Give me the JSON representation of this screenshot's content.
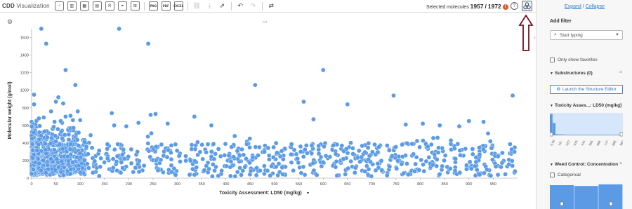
{
  "app": {
    "logo_main": "CDD",
    "logo_sub": " Visualization"
  },
  "toolbar": {
    "tools": [
      {
        "name": "scatter-plot-icon",
        "glyph": "⁘"
      },
      {
        "name": "bar-chart-icon",
        "glyph": "▥"
      },
      {
        "name": "histogram-icon",
        "glyph": "▦"
      },
      {
        "name": "grouped-chart-icon",
        "glyph": "▤"
      },
      {
        "name": "r-script-icon",
        "glyph": "R"
      },
      {
        "name": "structure-view-icon",
        "glyph": "⚭"
      },
      {
        "name": "grid-view-icon",
        "glyph": "⊞"
      }
    ],
    "exports": [
      {
        "name": "export-png-icon",
        "glyph": "PNG"
      },
      {
        "name": "export-pdf-icon",
        "glyph": "PDF"
      },
      {
        "name": "export-excel-icon",
        "glyph": "EXCEL"
      }
    ],
    "actions": [
      {
        "name": "link-icon",
        "glyph": "⛓",
        "disabled": true
      },
      {
        "name": "download-icon",
        "glyph": "⤓",
        "disabled": true
      },
      {
        "name": "open-external-icon",
        "glyph": "⇗",
        "disabled": false
      }
    ],
    "history": [
      {
        "name": "undo-icon",
        "glyph": "↶",
        "disabled": false
      },
      {
        "name": "redo-icon",
        "glyph": "↷",
        "disabled": true
      }
    ],
    "refresh": {
      "name": "refresh-icon",
      "glyph": "⇄"
    },
    "selected_label": "Selected molecules",
    "selected_count": "1957",
    "separator": "/",
    "total_count": "1972",
    "badge": "!",
    "help": "?",
    "filter_glyph": "⚙"
  },
  "panel": {
    "expand": "Expand",
    "slash": "/",
    "collapse": "Collapse",
    "add_filter": "Add filter",
    "search_placeholder": "Start typing",
    "only_favorites": "Only show favorites",
    "substructures": "Substructures (0)",
    "launch": "Launch the Structure Editor",
    "toxicity_filter": "Toxicity Asses...: LD50 (mg/kg)",
    "toxicity_ticks": [
      "0.00",
      "111",
      "222",
      "333",
      "444",
      "555",
      "666",
      "777",
      "888",
      "999"
    ],
    "toxicity_hist": [
      0.95,
      0.55,
      0.05,
      0.04,
      0.04,
      0.03,
      0.03,
      0.03,
      0.03,
      0.03,
      0.03,
      0.03,
      0.03,
      0.03,
      0.03,
      0.03,
      0.03,
      0.03,
      0.03,
      0.03,
      0.03,
      0.03,
      0.03,
      0.03,
      0.02
    ],
    "weed_filter": "Weed Control: Concentration",
    "categorical": "Categorical",
    "weed_hist": [
      0.85,
      0.82,
      0.88
    ]
  },
  "colors": {
    "point": "#5b9be6",
    "accent": "#2a7fd4",
    "annotation_arrow": "#7a1020"
  },
  "chart_data": {
    "type": "scatter",
    "xlabel": "Toxicity Assessment: LD50 (mg/kg)",
    "ylabel": "Molecular weight (g/mol)",
    "xlim": [
      0,
      1000
    ],
    "ylim": [
      0,
      1700
    ],
    "xticks": [
      0,
      50,
      100,
      150,
      200,
      250,
      300,
      350,
      400,
      450,
      500,
      550,
      600,
      650,
      700,
      750,
      800,
      850,
      900,
      950
    ],
    "yticks": [
      0,
      200,
      400,
      600,
      800,
      1000,
      1200,
      1400,
      1600
    ],
    "outliers": [
      [
        20,
        1700
      ],
      [
        180,
        1700
      ],
      [
        30,
        1530
      ],
      [
        240,
        1530
      ],
      [
        70,
        1230
      ],
      [
        600,
        1230
      ],
      [
        5,
        950
      ],
      [
        90,
        1060
      ],
      [
        460,
        1060
      ],
      [
        55,
        920
      ],
      [
        745,
        940
      ],
      [
        990,
        940
      ],
      [
        560,
        870
      ],
      [
        50,
        870
      ],
      [
        650,
        840
      ],
      [
        5,
        840
      ],
      [
        65,
        850
      ],
      [
        165,
        740
      ],
      [
        245,
        720
      ],
      [
        255,
        730
      ],
      [
        70,
        700
      ],
      [
        80,
        710
      ],
      [
        580,
        670
      ],
      [
        40,
        760
      ],
      [
        95,
        760
      ],
      [
        15,
        680
      ],
      [
        25,
        690
      ],
      [
        60,
        650
      ],
      [
        85,
        660
      ],
      [
        100,
        660
      ],
      [
        335,
        700
      ],
      [
        900,
        650
      ],
      [
        930,
        640
      ],
      [
        770,
        610
      ],
      [
        805,
        620
      ],
      [
        220,
        630
      ],
      [
        280,
        620
      ],
      [
        170,
        600
      ],
      [
        195,
        590
      ],
      [
        840,
        600
      ],
      [
        880,
        590
      ],
      [
        370,
        600
      ]
    ]
  }
}
